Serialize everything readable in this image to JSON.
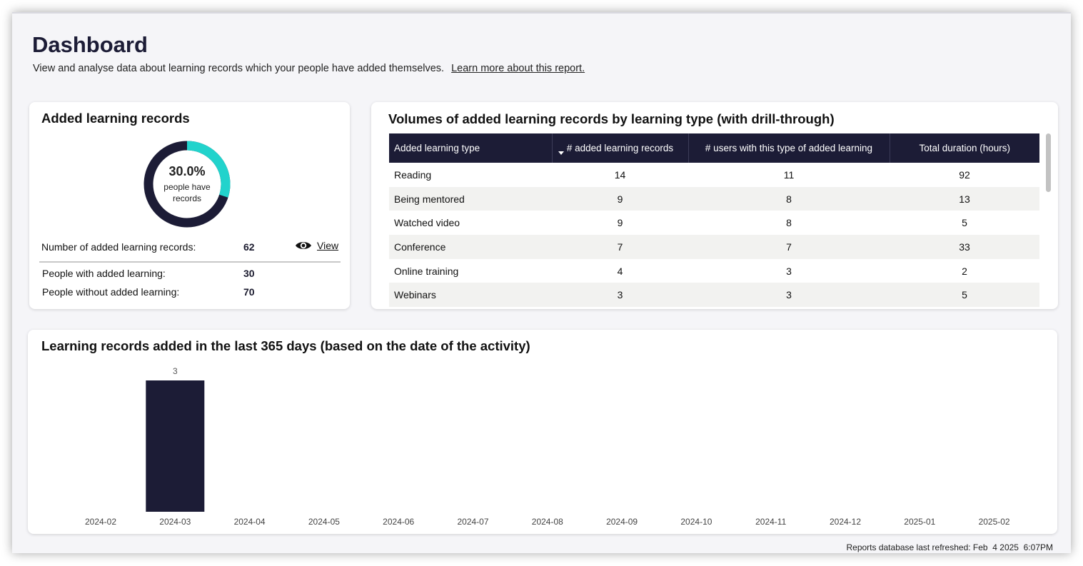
{
  "header": {
    "title": "Dashboard",
    "subtitle": "View and analyse data about learning records which your people have added themselves.",
    "learn_more_link": "Learn more about this report."
  },
  "records_card": {
    "title": "Added learning records",
    "donut": {
      "percent_label": "30.0%",
      "caption": "people have records",
      "fraction": 0.3,
      "fill_color": "#22d3cc",
      "track_color": "#1c1c36"
    },
    "number_label": "Number of added learning records:",
    "number_value": "62",
    "view_label": "View",
    "with_label": "People with added learning:",
    "with_value": "30",
    "without_label": "People without added learning:",
    "without_value": "70"
  },
  "table_card": {
    "title": "Volumes of added learning records by learning type (with drill-through)",
    "columns": [
      "Added learning type",
      "# added learning records",
      "# users with this type of added learning",
      "Total duration (hours)"
    ],
    "rows": [
      [
        "Reading",
        "14",
        "11",
        "92"
      ],
      [
        "Being mentored",
        "9",
        "8",
        "13"
      ],
      [
        "Watched video",
        "9",
        "8",
        "5"
      ],
      [
        "Conference",
        "7",
        "7",
        "33"
      ],
      [
        "Online training",
        "4",
        "3",
        "2"
      ],
      [
        "Webinars",
        "3",
        "3",
        "5"
      ]
    ]
  },
  "chart_card": {
    "title": "Learning records added in the last 365 days (based on the date of the activity)"
  },
  "chart_data": {
    "type": "bar",
    "title": "Learning records added in the last 365 days (based on the date of the activity)",
    "categories": [
      "2024-02",
      "2024-03",
      "2024-04",
      "2024-05",
      "2024-06",
      "2024-07",
      "2024-08",
      "2024-09",
      "2024-10",
      "2024-11",
      "2024-12",
      "2025-01",
      "2025-02"
    ],
    "values": [
      0,
      3,
      0,
      0,
      0,
      0,
      0,
      0,
      0,
      0,
      0,
      0,
      0
    ],
    "xlabel": "",
    "ylabel": "",
    "ylim": [
      0,
      3
    ],
    "grid": false,
    "bar_color": "#1c1c36",
    "data_labels": true
  },
  "footer": {
    "refresh_note": "Reports database last refreshed: Feb  4 2025  6:07PM"
  }
}
